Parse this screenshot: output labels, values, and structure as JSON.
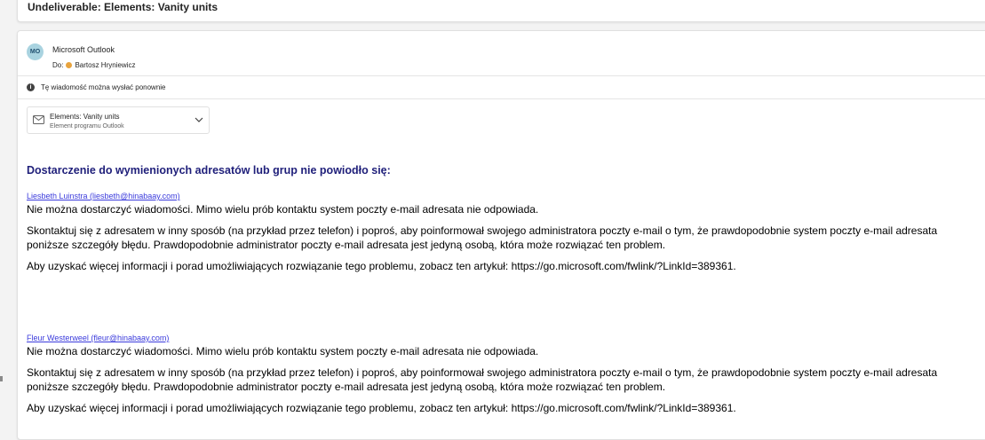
{
  "subject": "Undeliverable: Elements: Vanity units",
  "message": {
    "avatar_initials": "MO",
    "sender_name": "Microsoft Outlook",
    "to_label": "Do:",
    "recipient_name": "Bartosz Hryniewicz",
    "info_text": "Tę wiadomość można wysłać ponownie",
    "attachment": {
      "title": "Elements: Vanity units",
      "subtitle": "Element programu Outlook"
    },
    "body": {
      "heading": "Dostarczenie do wymienionych adresatów lub grup nie powiodło się:",
      "recipients": [
        {
          "link": "Liesbeth Luinstra (liesbeth@hinabaay.com)",
          "line1": "Nie można dostarczyć wiadomości. Mimo wielu prób kontaktu system poczty e-mail adresata nie odpowiada.",
          "line2": "Skontaktuj się z adresatem w inny sposób (na przykład przez telefon) i poproś, aby poinformował swojego administratora poczty e-mail o tym, że prawdopodobnie system poczty e-mail adresata",
          "line3": "poniższe szczegóły błędu. Prawdopodobnie administrator poczty e-mail adresata jest jedyną osobą, która może rozwiązać ten problem.",
          "line4": "Aby uzyskać więcej informacji i porad umożliwiających rozwiązanie tego problemu, zobacz ten artykuł: https://go.microsoft.com/fwlink/?LinkId=389361."
        },
        {
          "link": "Fleur Westerweel (fleur@hinabaay.com)",
          "line1": "Nie można dostarczyć wiadomości. Mimo wielu prób kontaktu system poczty e-mail adresata nie odpowiada.",
          "line2": "Skontaktuj się z adresatem w inny sposób (na przykład przez telefon) i poproś, aby poinformował swojego administratora poczty e-mail o tym, że prawdopodobnie system poczty e-mail adresata",
          "line3": "poniższe szczegóły błędu. Prawdopodobnie administrator poczty e-mail adresata jest jedyną osobą, która może rozwiązać ten problem.",
          "line4": "Aby uzyskać więcej informacji i porad umożliwiających rozwiązanie tego problemu, zobacz ten artykuł: https://go.microsoft.com/fwlink/?LinkId=389361."
        }
      ]
    }
  },
  "colors": {
    "heading": "#1f1f7a",
    "link": "#3b3bdc",
    "avatar_bg": "#a9d3e0",
    "presence_dot": "#e8a33d"
  },
  "icons": [
    "info-icon",
    "envelope-icon",
    "chevron-down-icon",
    "presence-dot-icon"
  ]
}
